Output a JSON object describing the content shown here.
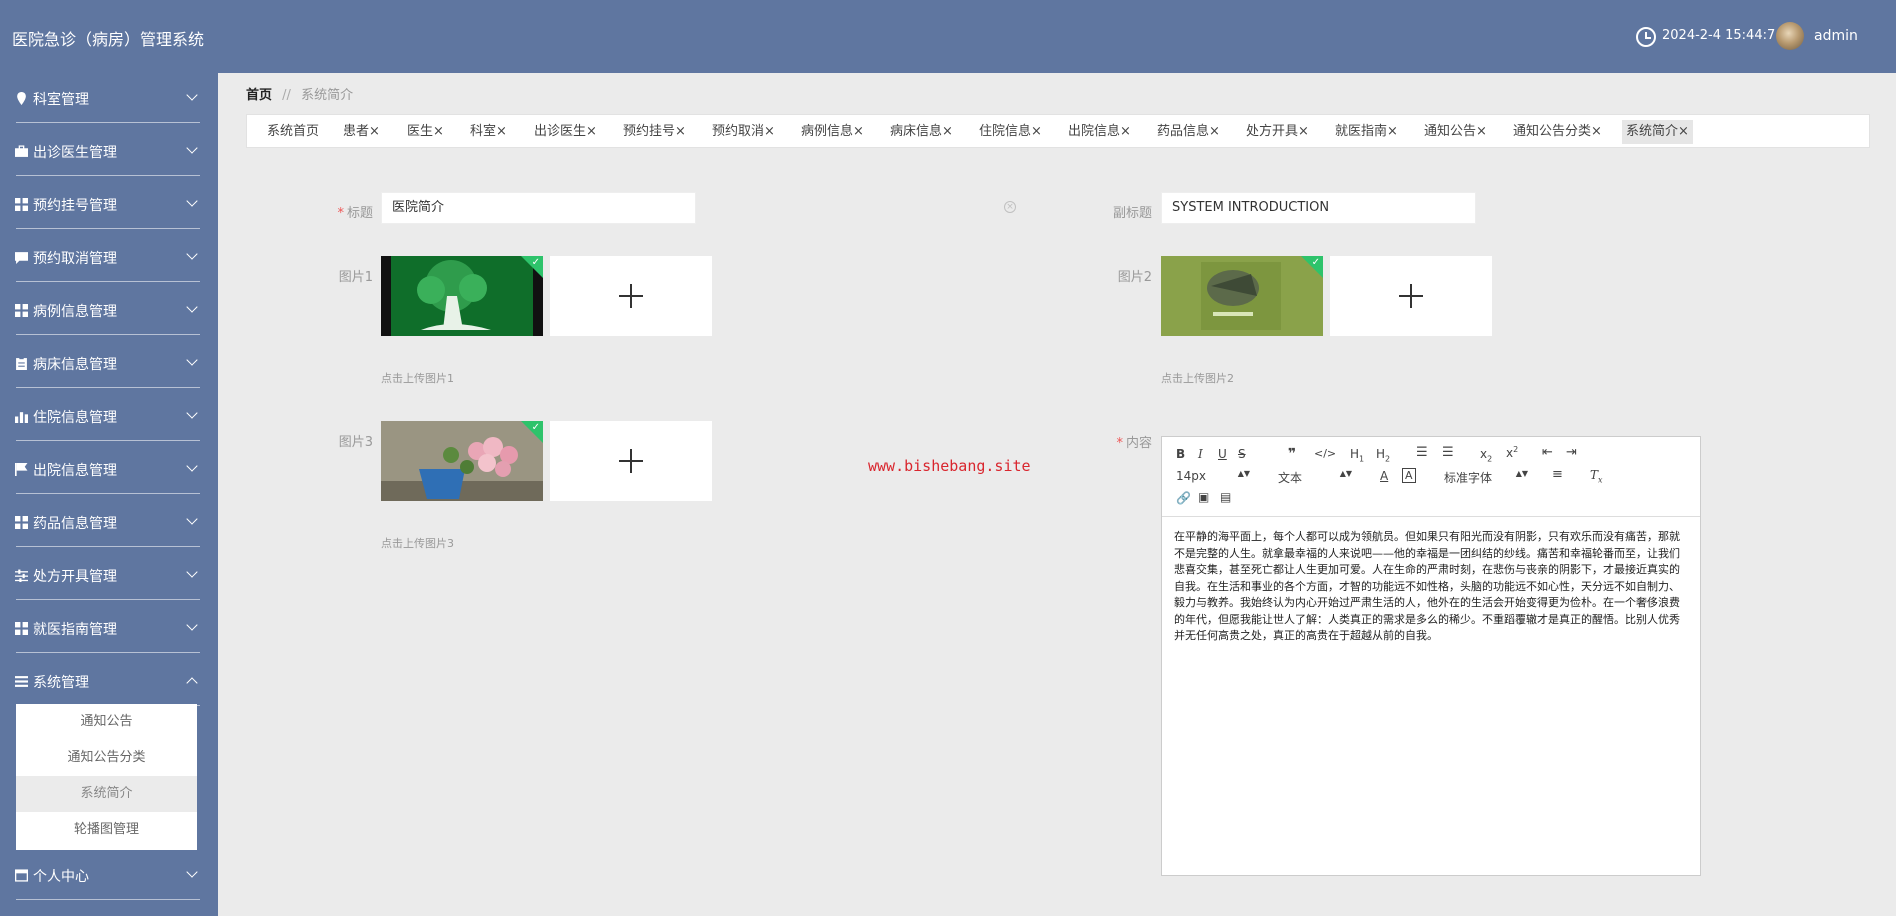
{
  "header": {
    "title": "医院急诊（病房）管理系统",
    "datetime": "2024-2-4 15:44:7",
    "username": "admin"
  },
  "sidebar": {
    "items": [
      {
        "label": "科室管理",
        "icon": "pin-icon"
      },
      {
        "label": "出诊医生管理",
        "icon": "briefcase-icon"
      },
      {
        "label": "预约挂号管理",
        "icon": "grid-icon"
      },
      {
        "label": "预约取消管理",
        "icon": "chat-icon"
      },
      {
        "label": "病例信息管理",
        "icon": "grid-icon"
      },
      {
        "label": "病床信息管理",
        "icon": "clipboard-icon"
      },
      {
        "label": "住院信息管理",
        "icon": "bar-chart-icon"
      },
      {
        "label": "出院信息管理",
        "icon": "flag-icon"
      },
      {
        "label": "药品信息管理",
        "icon": "grid-icon"
      },
      {
        "label": "处方开具管理",
        "icon": "sliders-icon"
      },
      {
        "label": "就医指南管理",
        "icon": "grid-icon"
      },
      {
        "label": "系统管理",
        "icon": "list-icon"
      },
      {
        "label": "个人中心",
        "icon": "window-icon"
      }
    ],
    "submenu": [
      "通知公告",
      "通知公告分类",
      "系统简介",
      "轮播图管理"
    ],
    "active_sub": "系统简介"
  },
  "breadcrumb": {
    "home": "首页",
    "separator": "//",
    "current": "系统简介"
  },
  "tabs": [
    "系统首页",
    "患者",
    "医生",
    "科室",
    "出诊医生",
    "预约挂号",
    "预约取消",
    "病例信息",
    "病床信息",
    "住院信息",
    "出院信息",
    "药品信息",
    "处方开具",
    "就医指南",
    "通知公告",
    "通知公告分类",
    "系统简介"
  ],
  "active_tab": "系统简介",
  "tab_close": "×",
  "form": {
    "title_label": "标题",
    "title_value": "医院简介",
    "subtitle_label": "副标题",
    "subtitle_value": "SYSTEM INTRODUCTION",
    "pic1_label": "图片1",
    "pic1_hint": "点击上传图片1",
    "pic2_label": "图片2",
    "pic2_hint": "点击上传图片2",
    "pic3_label": "图片3",
    "pic3_hint": "点击上传图片3",
    "content_label": "内容",
    "required_mark": "*"
  },
  "watermark": "www.bishebang.site",
  "editor": {
    "font_size": "14px",
    "text_type": "文本",
    "font_family": "标准字体",
    "content": "在平静的海平面上，每个人都可以成为领航员。但如果只有阳光而没有阴影，只有欢乐而没有痛苦，那就不是完整的人生。就拿最幸福的人来说吧——他的幸福是一团纠结的纱线。痛苦和幸福轮番而至，让我们悲喜交集，甚至死亡都让人生更加可爱。人在生命的严肃时刻，在悲伤与丧亲的阴影下，才最接近真实的自我。在生活和事业的各个方面，才智的功能远不如性格，头脑的功能远不如心性，天分远不如自制力、毅力与教养。我始终认为内心开始过严肃生活的人，他外在的生活会开始变得更为俭朴。在一个奢侈浪费的年代，但愿我能让世人了解：人类真正的需求是多么的稀少。不重蹈覆辙才是真正的醒悟。比别人优秀并无任何高贵之处，真正的高贵在于超越从前的自我。"
  },
  "colors": {
    "header_bg": "#5f76a0",
    "sidebar_bg": "#5f76a0",
    "page_bg": "#ebebeb",
    "required": "#e55555",
    "watermark": "#d9262e",
    "upload_ok": "#2ec36b"
  }
}
